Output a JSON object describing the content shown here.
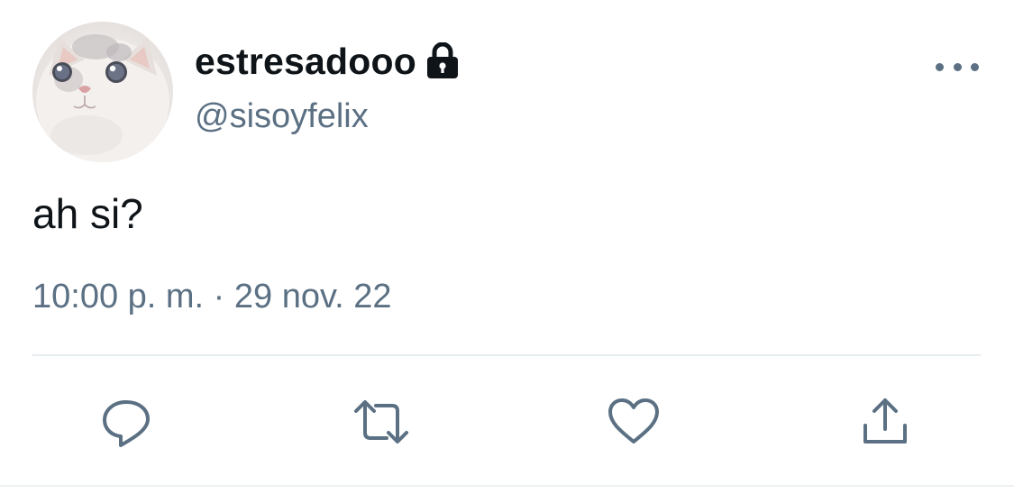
{
  "tweet": {
    "display_name": "estresadooo",
    "handle": "@sisoyfelix",
    "text": "ah si?",
    "timestamp": "10:00 p. m. · 29 nov. 22",
    "account_locked": true
  },
  "icons": {
    "avatar": "cat-avatar",
    "lock": "lock-icon",
    "more": "more-options-icon",
    "reply": "reply-icon",
    "retweet": "retweet-icon",
    "like": "heart-icon",
    "share": "share-icon"
  },
  "colors": {
    "text_primary": "#0f1419",
    "text_secondary": "#5b7083",
    "divider": "#e6ecf0",
    "background": "#ffffff"
  }
}
